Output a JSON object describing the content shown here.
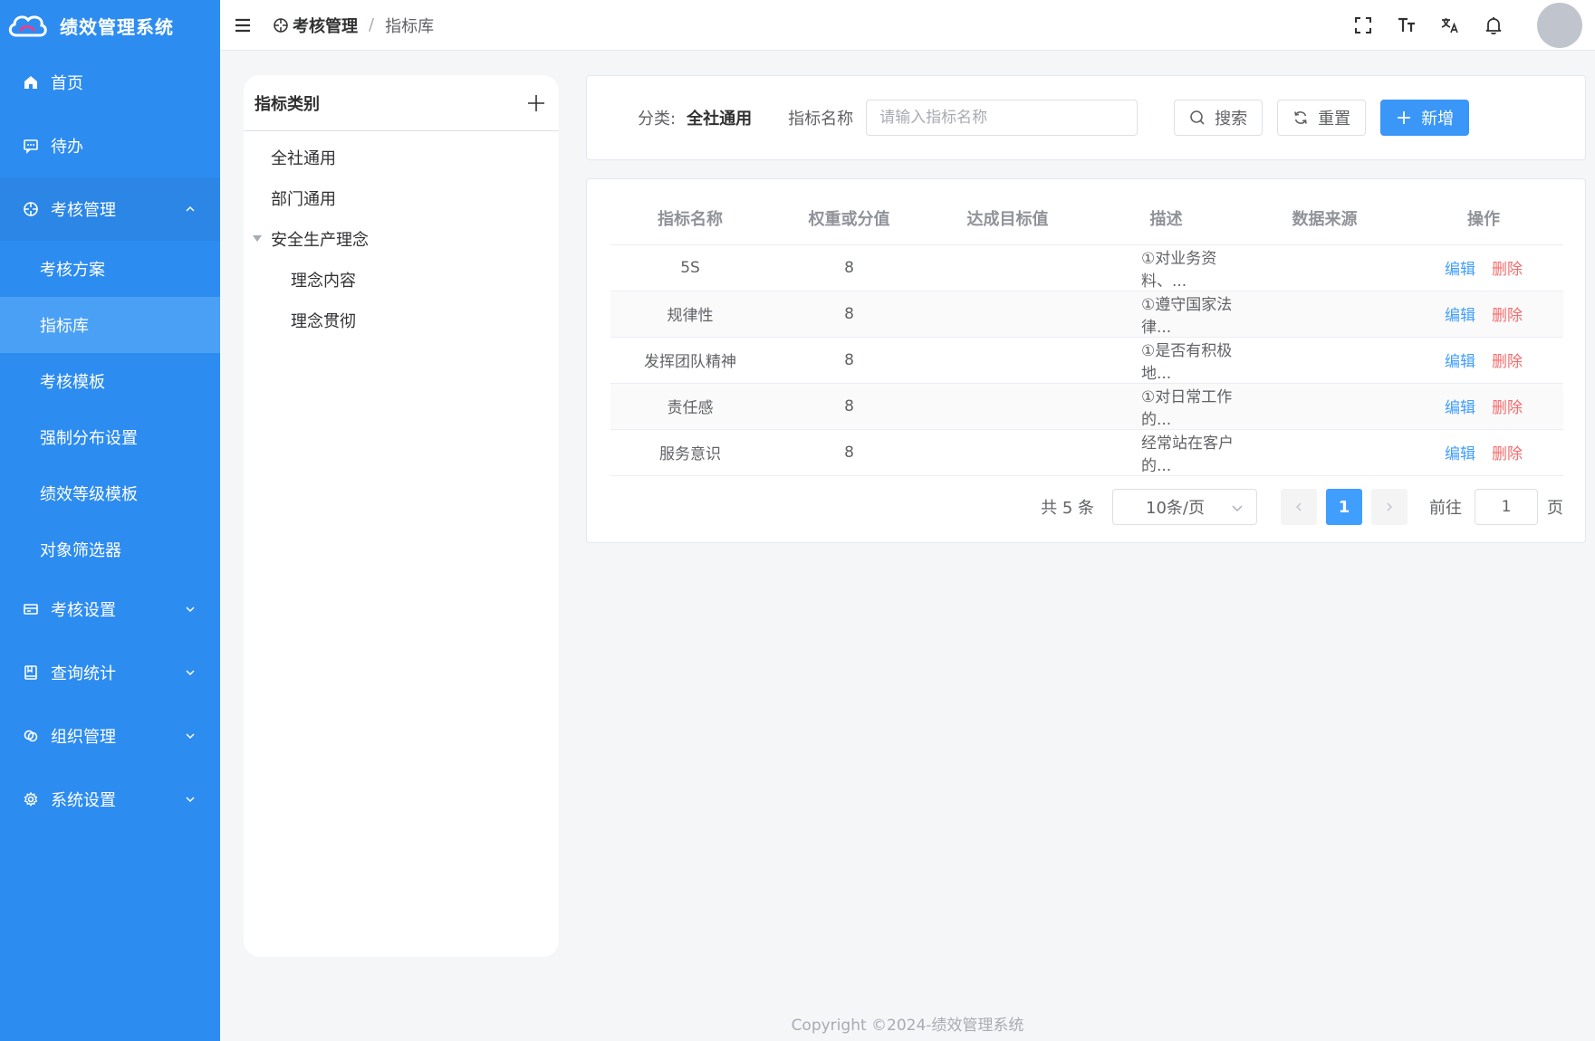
{
  "app": {
    "title": "绩效管理系统"
  },
  "sidebar": {
    "items": [
      {
        "label": "首页",
        "icon": "home-icon"
      },
      {
        "label": "待办",
        "icon": "message-icon"
      },
      {
        "label": "考核管理",
        "icon": "target-icon",
        "expanded": true,
        "children": [
          {
            "label": "考核方案"
          },
          {
            "label": "指标库",
            "active": true
          },
          {
            "label": "考核模板"
          },
          {
            "label": "强制分布设置"
          },
          {
            "label": "绩效等级模板"
          },
          {
            "label": "对象筛选器"
          }
        ]
      },
      {
        "label": "考核设置",
        "icon": "card-icon"
      },
      {
        "label": "查询统计",
        "icon": "book-icon"
      },
      {
        "label": "组织管理",
        "icon": "link-icon"
      },
      {
        "label": "系统设置",
        "icon": "gear-icon"
      }
    ]
  },
  "header": {
    "breadcrumb": {
      "parent": "考核管理",
      "separator": "/",
      "current": "指标库"
    },
    "tools": [
      "fullscreen-icon",
      "font-size-icon",
      "translate-icon",
      "bell-icon"
    ]
  },
  "category_panel": {
    "title": "指标类别",
    "nodes": [
      {
        "label": "全社通用"
      },
      {
        "label": "部门通用"
      },
      {
        "label": "安全生产理念",
        "expanded": true
      },
      {
        "label": "理念内容"
      },
      {
        "label": "理念贯彻"
      }
    ]
  },
  "search": {
    "category_label": "分类:",
    "category_value": "全社通用",
    "name_label": "指标名称",
    "name_placeholder": "请输入指标名称",
    "search_label": "搜索",
    "reset_label": "重置",
    "add_label": "新增"
  },
  "table": {
    "columns": [
      "指标名称",
      "权重或分值",
      "达成目标值",
      "描述",
      "数据来源",
      "操作"
    ],
    "rows": [
      {
        "name": "5S",
        "weight": "8",
        "target": "",
        "desc": "①对业务资料、...",
        "source": ""
      },
      {
        "name": "规律性",
        "weight": "8",
        "target": "",
        "desc": "①遵守国家法律...",
        "source": ""
      },
      {
        "name": "发挥团队精神",
        "weight": "8",
        "target": "",
        "desc": "①是否有积极地...",
        "source": ""
      },
      {
        "name": "责任感",
        "weight": "8",
        "target": "",
        "desc": "①对日常工作的...",
        "source": ""
      },
      {
        "name": "服务意识",
        "weight": "8",
        "target": "",
        "desc": "经常站在客户的...",
        "source": ""
      }
    ],
    "edit_label": "编辑",
    "delete_label": "删除"
  },
  "pagination": {
    "total_text": "共 5 条",
    "page_size": "10条/页",
    "current_page": "1",
    "goto_label": "前往",
    "goto_value": "1",
    "page_unit": "页"
  },
  "footer": {
    "copyright": "Copyright ©2024-绩效管理系统"
  },
  "colors": {
    "sidebar": "#2d8cf0",
    "active": "#4aa0f5",
    "primary": "#409eff",
    "danger": "#f56c6c"
  }
}
